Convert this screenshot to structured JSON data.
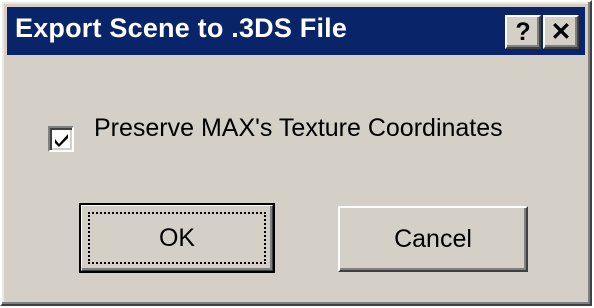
{
  "window": {
    "title": "Export Scene to .3DS File",
    "help_label": "?",
    "close_label": "✕"
  },
  "options": {
    "preserve_texture_label": "Preserve MAX's Texture Coordinates",
    "preserve_texture_checked": true
  },
  "buttons": {
    "ok_label": "OK",
    "cancel_label": "Cancel"
  },
  "colors": {
    "titlebar": "#0a246a",
    "face": "#d4d0c8"
  }
}
